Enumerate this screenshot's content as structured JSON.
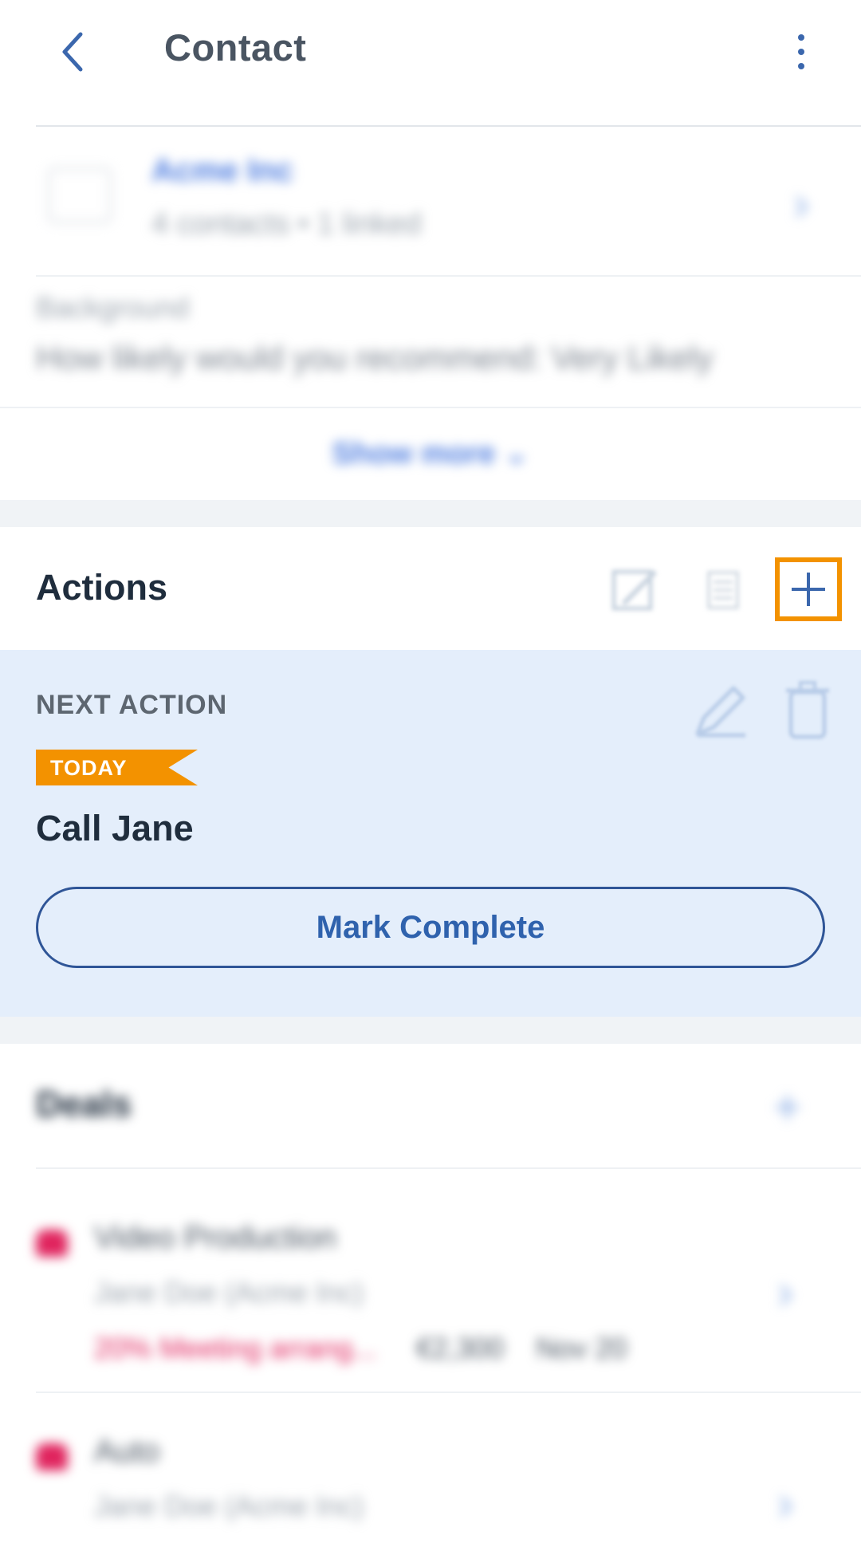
{
  "header": {
    "title": "Contact",
    "back_icon": "chevron-left-icon",
    "more_icon": "more-vertical-icon"
  },
  "company": {
    "name": "Acme Inc",
    "subtitle": "4 contacts • 1 linked"
  },
  "background": {
    "label": "Background",
    "text": "How likely would you recommend: Very Likely"
  },
  "show_more": {
    "label": "Show more ⌄"
  },
  "actions": {
    "title": "Actions"
  },
  "next_action": {
    "label": "NEXT ACTION",
    "badge": "TODAY",
    "title": "Call Jane",
    "mark_complete_label": "Mark Complete"
  },
  "deals": {
    "title": "Deals",
    "items": [
      {
        "name": "Video Production",
        "person": "Jane Doe (Acme Inc)",
        "stage": "20% Meeting arrang...",
        "value": "€2,300",
        "date": "Nov 20"
      },
      {
        "name": "Auto",
        "person": "Jane Doe (Acme Inc)"
      }
    ]
  },
  "colors": {
    "accent": "#3b67ad",
    "highlight": "#f39200",
    "next_action_bg": "#e4eefb",
    "deal_red": "#e0245e"
  }
}
